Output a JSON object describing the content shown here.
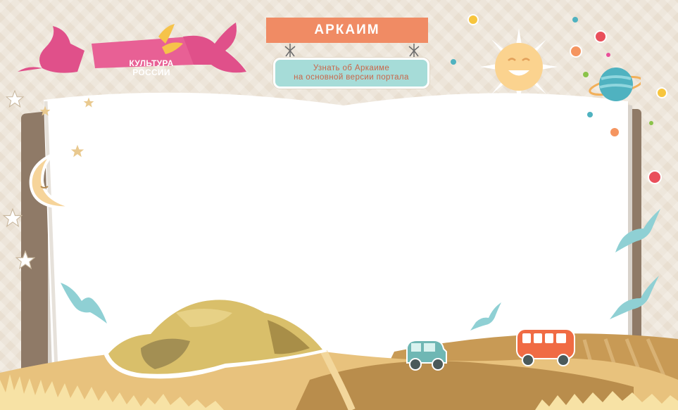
{
  "logo": {
    "line1": "КУЛЬТУРА",
    "line2": "РОССИИ"
  },
  "header": {
    "title": "АРКАИМ"
  },
  "link": {
    "line1": "Узнать об Аркаиме",
    "line2": "на основной версии портала"
  },
  "colors": {
    "background": "#e9dfd1",
    "title_board": "#f08b64",
    "link_sign": "#a6dcd8",
    "link_text": "#c9664a",
    "logo_ribbon": "#e0508a",
    "bird": "#8fd0d4",
    "sun": "#fbd38f"
  },
  "icons": [
    "culture-russia-logo",
    "sun-icon",
    "planet-icon",
    "moon-icon",
    "star-icon",
    "bird-icon",
    "car-icon",
    "bus-icon",
    "rock-mound-icon"
  ]
}
